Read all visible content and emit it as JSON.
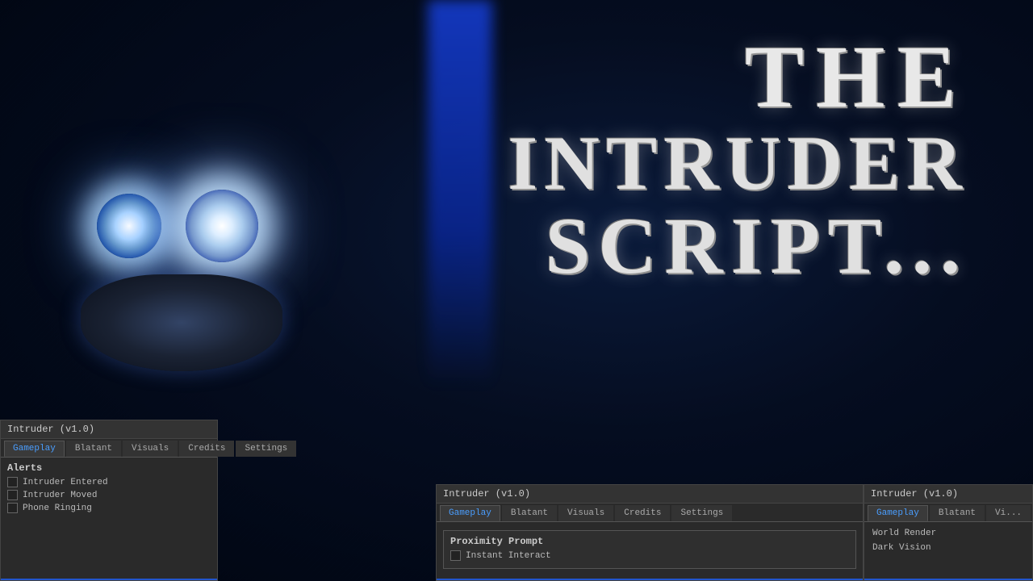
{
  "background": {
    "color": "#000510"
  },
  "title": {
    "the": "THE",
    "intruder": "INTRUDER",
    "script": "SCRIPT..."
  },
  "panel_left": {
    "title": "Intruder (v1.0)",
    "tabs": [
      {
        "label": "Gameplay",
        "active": true
      },
      {
        "label": "Blatant",
        "active": false
      },
      {
        "label": "Visuals",
        "active": false
      },
      {
        "label": "Credits",
        "active": false
      },
      {
        "label": "Settings",
        "active": false
      }
    ],
    "section_title": "Alerts",
    "checkboxes": [
      {
        "label": "Intruder Entered",
        "checked": false
      },
      {
        "label": "Intruder Moved",
        "checked": false
      },
      {
        "label": "Phone Ringing",
        "checked": false
      }
    ]
  },
  "panel_center": {
    "title": "Intruder (v1.0)",
    "tabs": [
      {
        "label": "Gameplay",
        "active": true
      },
      {
        "label": "Blatant",
        "active": false
      },
      {
        "label": "Visuals",
        "active": false
      },
      {
        "label": "Credits",
        "active": false
      },
      {
        "label": "Settings",
        "active": false
      }
    ],
    "subsection_title": "Proximity Prompt",
    "checkboxes": [
      {
        "label": "Instant Interact",
        "checked": false
      }
    ]
  },
  "panel_right": {
    "title": "Intruder (v1.0)",
    "tabs": [
      {
        "label": "Gameplay",
        "active": true
      },
      {
        "label": "Blatant",
        "active": false
      },
      {
        "label": "Vi...",
        "active": false
      }
    ],
    "items": [
      {
        "label": "World Render"
      },
      {
        "label": "Dark Vision"
      }
    ]
  },
  "bottom_tab": {
    "label": "Gameplay"
  }
}
